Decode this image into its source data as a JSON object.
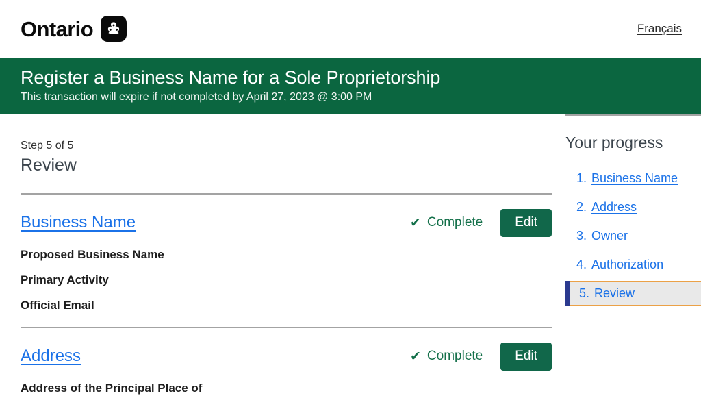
{
  "header": {
    "brand_word": "Ontario",
    "logo_icon": "ontario-trillium-icon",
    "language_link": "Français"
  },
  "banner": {
    "title": "Register a Business Name for a Sole Proprietorship",
    "subtitle": "This transaction will expire if not completed by April 27, 2023 @ 3:00 PM",
    "background_color": "#0b6640"
  },
  "step": {
    "counter": "Step 5 of 5",
    "title": "Review"
  },
  "sections": [
    {
      "link_label": "Business Name",
      "status_label": "Complete",
      "status_icon": "checkmark-icon",
      "edit_label": "Edit",
      "fields": [
        "Proposed Business Name",
        "Primary Activity",
        "Official Email"
      ]
    },
    {
      "link_label": "Address",
      "status_label": "Complete",
      "status_icon": "checkmark-icon",
      "edit_label": "Edit",
      "fields": [
        "Address of the Principal Place of"
      ]
    }
  ],
  "sidebar": {
    "title": "Your progress",
    "items": [
      {
        "number": "1.",
        "label": "Business Name"
      },
      {
        "number": "2.",
        "label": "Address"
      },
      {
        "number": "3.",
        "label": "Owner"
      },
      {
        "number": "4.",
        "label": "Authorization"
      },
      {
        "number": "5.",
        "label": "Review"
      }
    ],
    "active_index": 4,
    "active_outline_color": "#eba147",
    "active_bar_color": "#2b3a8f"
  },
  "colors": {
    "brand_green": "#0b6640",
    "button_green": "#11674a",
    "link_blue": "#1b72e8",
    "status_green": "#14704a",
    "divider_gray": "#a3a3a3"
  }
}
